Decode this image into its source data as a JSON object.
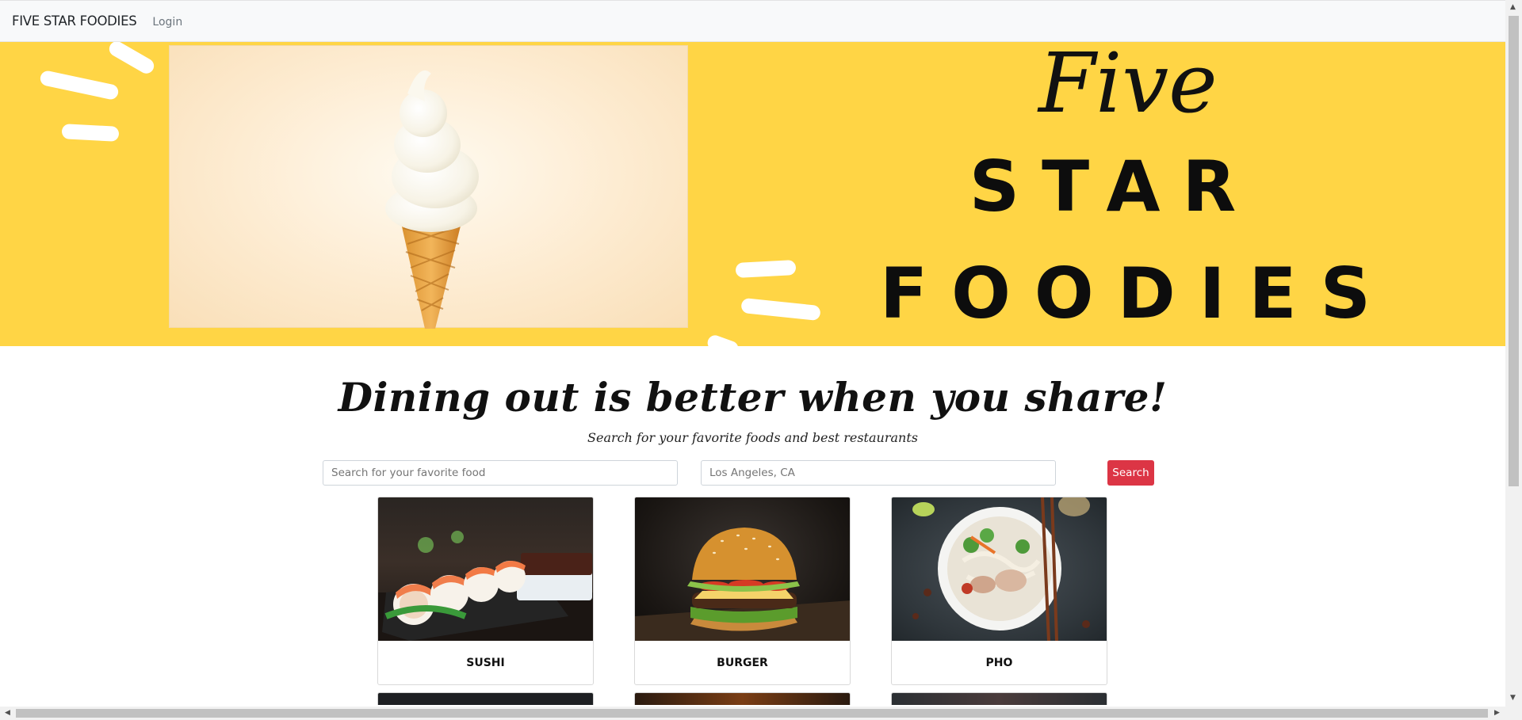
{
  "navbar": {
    "brand": "FIVE STAR FOODIES",
    "login": "Login"
  },
  "hero": {
    "logo_line1": "Five",
    "logo_line2": "STAR",
    "logo_line3": "FOODIES",
    "background_color": "#ffd545"
  },
  "main": {
    "headline": "Dining out is better when you share!",
    "subheadline": "Search for your favorite foods and best restaurants"
  },
  "search": {
    "food_placeholder": "Search for your favorite food",
    "location_placeholder": "Los Angeles, CA",
    "button_label": "Search",
    "button_color": "#dc3545"
  },
  "cards": [
    {
      "title": "SUSHI",
      "icon": "sushi-photo"
    },
    {
      "title": "BURGER",
      "icon": "burger-photo"
    },
    {
      "title": "PHO",
      "icon": "pho-photo"
    }
  ],
  "scrollbars": {
    "up": "▲",
    "down": "▼",
    "left": "◀",
    "right": "▶"
  }
}
